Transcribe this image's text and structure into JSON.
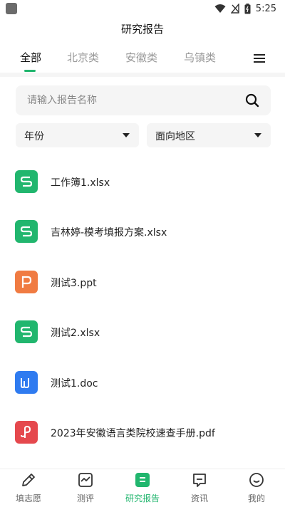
{
  "status_bar": {
    "time": "5:25"
  },
  "header": {
    "title": "研究报告"
  },
  "tabs": {
    "items": [
      {
        "label": "全部",
        "active": true
      },
      {
        "label": "北京类",
        "active": false
      },
      {
        "label": "安徽类",
        "active": false
      },
      {
        "label": "乌镇类",
        "active": false
      }
    ],
    "accent": "#21b66e"
  },
  "search": {
    "placeholder": "请输入报告名称",
    "value": ""
  },
  "filters": {
    "year_label": "年份",
    "region_label": "面向地区"
  },
  "files": [
    {
      "name": "工作簿1.xlsx",
      "type": "xlsx",
      "icon": "spreadsheet-icon",
      "color": "#21b66e"
    },
    {
      "name": "吉林婷-模考填报方案.xlsx",
      "type": "xlsx",
      "icon": "spreadsheet-icon",
      "color": "#21b66e"
    },
    {
      "name": "测试3.ppt",
      "type": "ppt",
      "icon": "presentation-icon",
      "color": "#f07b42"
    },
    {
      "name": "测试2.xlsx",
      "type": "xlsx",
      "icon": "spreadsheet-icon",
      "color": "#21b66e"
    },
    {
      "name": "测试1.doc",
      "type": "doc",
      "icon": "document-icon",
      "color": "#2f7bf0"
    },
    {
      "name": "2023年安徽语言类院校速查手册.pdf",
      "type": "pdf",
      "icon": "pdf-icon",
      "color": "#e5484d"
    }
  ],
  "bottom_nav": [
    {
      "label": "填志愿",
      "icon": "pencil-icon",
      "active": false
    },
    {
      "label": "测评",
      "icon": "chart-icon",
      "active": false
    },
    {
      "label": "研究报告",
      "icon": "report-icon",
      "active": true
    },
    {
      "label": "资讯",
      "icon": "message-icon",
      "active": false
    },
    {
      "label": "我的",
      "icon": "smile-icon",
      "active": false
    }
  ],
  "colors": {
    "accent": "#21b66e",
    "muted": "#999999",
    "surface": "#f5f5f5"
  }
}
